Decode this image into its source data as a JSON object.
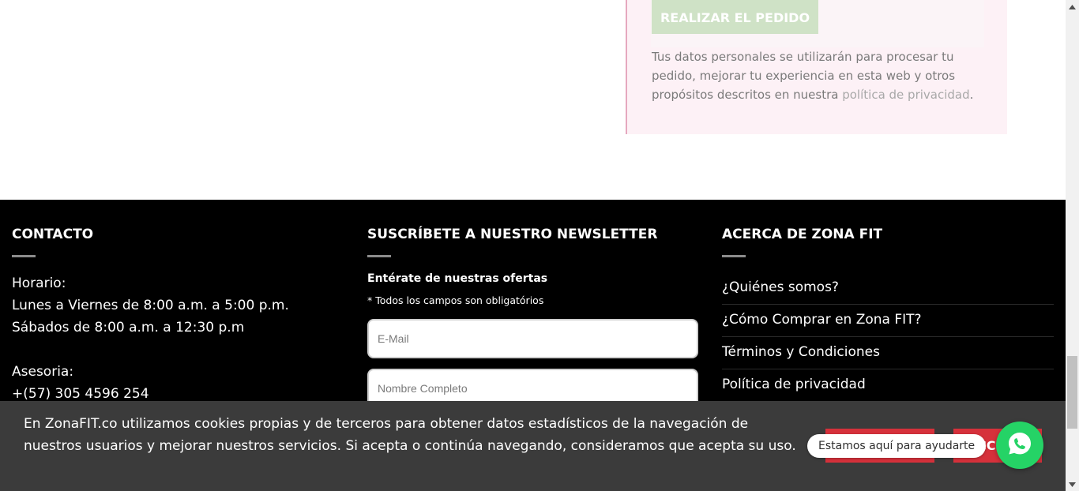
{
  "checkout": {
    "order_button": "REALIZAR EL PEDIDO",
    "privacy_text": "Tus datos personales se utilizarán para procesar tu pedido, mejorar tu experiencia en esta web y otros propósitos descritos en nuestra",
    "privacy_link": "política de privacidad",
    "privacy_end": "."
  },
  "footer": {
    "contact": {
      "title": "CONTACTO",
      "lines": [
        "Horario:",
        "Lunes a Viernes de 8:00 a.m. a 5:00 p.m.",
        "Sábados de 8:00 a.m. a 12:30 p.m",
        "",
        "Asesoria:",
        "+(57) 305 4596 254"
      ]
    },
    "newsletter": {
      "title": "SUSCRÍBETE A NUESTRO NEWSLETTER",
      "subtitle": "Entérate de nuestras ofertas",
      "note": "* Todos los campos son obligatórios",
      "email_placeholder": "E-Mail",
      "name_placeholder": "Nombre Completo"
    },
    "about": {
      "title": "ACERCA DE ZONA FIT",
      "links": [
        "¿Quiénes somos?",
        "¿Cómo Comprar en Zona FIT?",
        "Términos y Condiciones",
        "Política de privacidad"
      ]
    }
  },
  "cookie": {
    "text": "En ZonaFIT.co utilizamos cookies propias y de terceros para obtener datos estadísticos de la navegación de nuestros usuarios y mejorar nuestros servicios. Si acepta o continúa navegando, consideramos que acepta su uso.",
    "button_b_visible": "CC"
  },
  "chat": {
    "bubble": "Estamos aquí para ayudarte",
    "icon": "whatsapp-icon"
  },
  "colors": {
    "accent_red": "#d6313b",
    "order_green": "#cfe2c6",
    "whatsapp_green": "#25d366"
  }
}
